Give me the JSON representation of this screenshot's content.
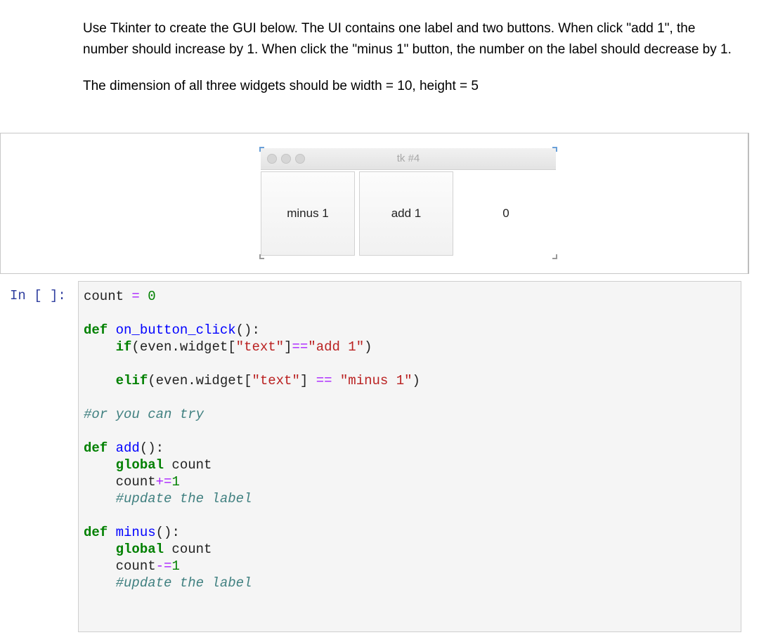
{
  "instructions": {
    "paragraph1": "Use Tkinter to create the GUI below. The UI contains one label and two buttons. When click \"add 1\", the number should increase by 1. When click the \"minus 1\" button, the number on the label should decrease by 1.",
    "paragraph2": "The dimension of all three widgets should be width = 10, height = 5"
  },
  "tk_window": {
    "title": "tk #4",
    "button_minus": "minus 1",
    "button_add": "add 1",
    "label_value": "0"
  },
  "cell": {
    "prompt": "In [ ]:",
    "lines": {
      "l1": {
        "a": "count",
        "b": " = ",
        "c": "0"
      },
      "l3": {
        "a": "def",
        "b": " ",
        "c": "on_button_click",
        "d": "():"
      },
      "l4": {
        "a": "    ",
        "b": "if",
        "c": "(even.widget[",
        "d": "\"text\"",
        "e": "]",
        "f": "==",
        "g": "\"add 1\"",
        "h": ")"
      },
      "l6": {
        "a": "    ",
        "b": "elif",
        "c": "(even.widget[",
        "d": "\"text\"",
        "e": "] ",
        "f": "==",
        "g": " ",
        "h": "\"minus 1\"",
        "i": ")"
      },
      "l8": {
        "a": "#or you can try"
      },
      "l10": {
        "a": "def",
        "b": " ",
        "c": "add",
        "d": "():"
      },
      "l11": {
        "a": "    ",
        "b": "global",
        "c": " count"
      },
      "l12": {
        "a": "    count",
        "b": "+=",
        "c": "1"
      },
      "l13": {
        "a": "    ",
        "b": "#update the label"
      },
      "l15": {
        "a": "def",
        "b": " ",
        "c": "minus",
        "d": "():"
      },
      "l16": {
        "a": "    ",
        "b": "global",
        "c": " count"
      },
      "l17": {
        "a": "    count",
        "b": "-=",
        "c": "1"
      },
      "l18": {
        "a": "    ",
        "b": "#update the label"
      }
    }
  }
}
